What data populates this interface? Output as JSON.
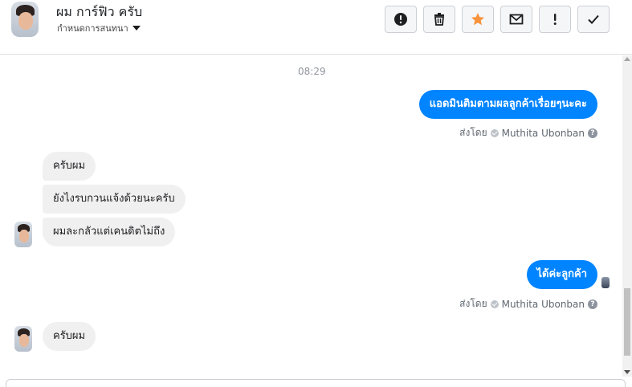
{
  "header": {
    "contact_name": "ผม การ์ฟิว ครับ",
    "assign_label": "กำหนดการสนทนา"
  },
  "toolbar": {
    "buttons": [
      {
        "name": "mark-spam",
        "icon": "alert-circle-icon"
      },
      {
        "name": "delete",
        "icon": "trash-icon"
      },
      {
        "name": "star",
        "icon": "star-icon",
        "color": "#f7923b"
      },
      {
        "name": "mark-unread",
        "icon": "envelope-icon"
      },
      {
        "name": "follow-up",
        "icon": "exclamation-icon"
      },
      {
        "name": "mark-done",
        "icon": "checkmark-icon"
      }
    ]
  },
  "thread": {
    "timestamp": "08:29",
    "messages": [
      {
        "direction": "out",
        "text": "แอดมินติมตามผลลูกค้าเรื่อยๆนะคะ"
      },
      {
        "direction": "in",
        "text": "ครับผม"
      },
      {
        "direction": "in",
        "text": "ยังไงรบกวนแจ้งด้วยนะครับ"
      },
      {
        "direction": "in",
        "text": "ผมละกลัวแต่เคนดิตไม่ถึง"
      },
      {
        "direction": "out",
        "text": "ได้ค่ะลูกค้า"
      },
      {
        "direction": "in",
        "text": "ครับผม"
      }
    ],
    "sent_by": {
      "prefix": "ส่งโดย",
      "agent_name": "Muthita Ubonban"
    }
  },
  "colors": {
    "outgoing_bubble": "#0084ff",
    "incoming_bubble": "#f1f0f0",
    "star": "#f7923b"
  }
}
